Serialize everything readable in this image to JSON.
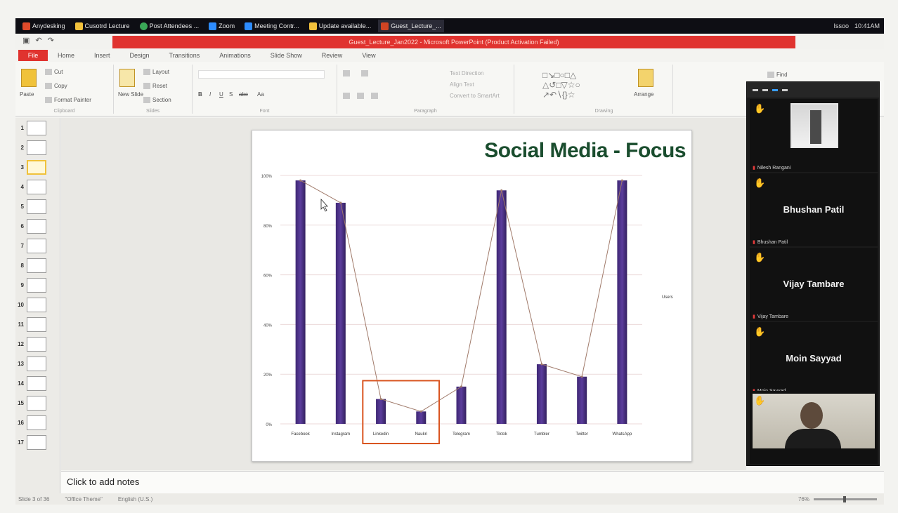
{
  "taskbar": {
    "items": [
      "Anydesking",
      "Cusotrd Lecture",
      "Post Attendees ...",
      "Zoom",
      "Meeting Contr...",
      "Update available...",
      "Guest_Lecture_..."
    ],
    "tray_text": "Issoo",
    "clock": "10:41AM"
  },
  "powerpoint": {
    "window_title": "Guest_Lecture_Jan2022 - Microsoft PowerPoint (Product Activation Failed)",
    "file_tab": "File",
    "tabs": [
      "Home",
      "Insert",
      "Design",
      "Transitions",
      "Animations",
      "Slide Show",
      "Review",
      "View"
    ],
    "ribbon": {
      "clipboard": {
        "paste": "Paste",
        "cut": "Cut",
        "copy": "Copy",
        "format_painter": "Format Painter",
        "label": "Clipboard"
      },
      "slides": {
        "new_slide": "New Slide",
        "layout": "Layout",
        "reset": "Reset",
        "section": "Section",
        "label": "Slides"
      },
      "font": {
        "label": "Font"
      },
      "paragraph": {
        "text_direction": "Text Direction",
        "align_text": "Align Text",
        "convert_smartart": "Convert to SmartArt",
        "label": "Paragraph"
      },
      "drawing": {
        "arrange": "Arrange",
        "label": "Drawing"
      },
      "editing": {
        "find": "Find"
      }
    },
    "thumbnails": [
      "1",
      "2",
      "3",
      "4",
      "5",
      "6",
      "7",
      "8",
      "9",
      "10",
      "11",
      "12",
      "13",
      "14",
      "15",
      "16",
      "17"
    ],
    "selected_thumbnail": "3",
    "notes_placeholder": "Click to add notes",
    "status": {
      "slide": "Slide 3 of 36",
      "theme": "\"Office Theme\"",
      "language": "English (U.S.)",
      "zoom": "76%"
    }
  },
  "slide": {
    "title": "Social Media - Focus"
  },
  "chart_data": {
    "type": "bar",
    "categories": [
      "Facebook",
      "Instagram",
      "Linkedin",
      "Naukri",
      "Telegram",
      "Tiktok",
      "Tumbler",
      "Twitter",
      "WhatsApp"
    ],
    "values": [
      98,
      89,
      10,
      5,
      15,
      94,
      24,
      19,
      98
    ],
    "line_overlay": true,
    "legend": "Users",
    "legend_position": "right",
    "ylim": [
      0,
      100
    ],
    "y_ticks": [
      "0%",
      "20%",
      "40%",
      "60%",
      "80%",
      "100%"
    ],
    "highlighted_categories": [
      "Linkedin",
      "Naukri"
    ],
    "colors": {
      "bar": "#5b3d9c",
      "line": "#a07a6a",
      "highlight_box": "#d9541f"
    }
  },
  "zoom_panel": {
    "participants": [
      {
        "display": "",
        "label": "Nilesh Rangani",
        "has_photo": true
      },
      {
        "display": "Bhushan Patil",
        "label": "Bhushan Patil"
      },
      {
        "display": "Vijay Tambare",
        "label": "Vijay Tambare"
      },
      {
        "display": "Moin Sayyad",
        "label": "Moin Sayyad"
      },
      {
        "display": "",
        "label": "",
        "has_camera": true
      }
    ]
  }
}
